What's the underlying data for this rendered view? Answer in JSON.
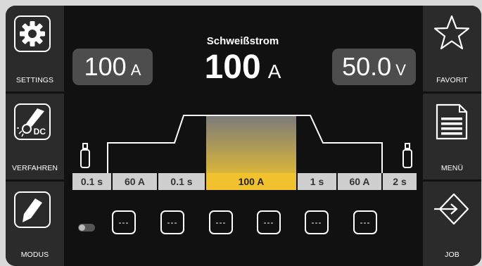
{
  "left_menu": [
    {
      "label": "SETTINGS",
      "icon": "gear-icon"
    },
    {
      "label": "VERFAHREN",
      "icon": "torch-dc-icon",
      "icon_text": "DC"
    },
    {
      "label": "MODUS",
      "icon": "pencil-icon"
    }
  ],
  "right_menu": [
    {
      "label": "FAVORIT",
      "icon": "star-icon"
    },
    {
      "label": "MENÜ",
      "icon": "menu-document-icon"
    },
    {
      "label": "JOB",
      "icon": "job-arrow-icon"
    }
  ],
  "display": {
    "title": "Schweißstrom",
    "main_value": "100",
    "main_unit": "A",
    "left_value": "100",
    "left_unit": "A",
    "right_value": "50.0",
    "right_unit": "V"
  },
  "sequence": [
    "0.1 s",
    "60 A",
    "0.1 s",
    "100 A",
    "1 s",
    "60 A",
    "2 s"
  ],
  "job_slots": [
    "---",
    "---",
    "---",
    "---",
    "---",
    "---"
  ],
  "colors": {
    "accent": "#f2c12e",
    "frame": "#111111",
    "side_panel": "#2b2b2b",
    "value_box": "#4d4d4d"
  }
}
